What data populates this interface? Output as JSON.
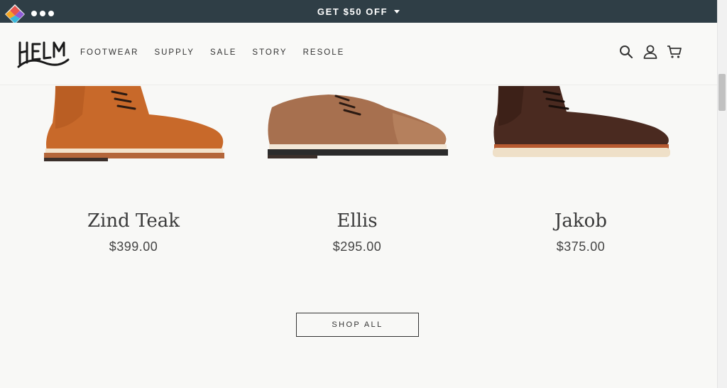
{
  "promo_bar": {
    "text": "GET $50 OFF",
    "caret_icon": "caret-down-icon",
    "background": "#2f3e46"
  },
  "extension": {
    "logo_icon": "extension-logo-icon",
    "menu_icon": "more-dots-icon"
  },
  "header": {
    "logo_text": "HELM",
    "nav": [
      {
        "label": "FOOTWEAR"
      },
      {
        "label": "SUPPLY"
      },
      {
        "label": "SALE"
      },
      {
        "label": "STORY"
      },
      {
        "label": "RESOLE"
      }
    ],
    "icons": [
      "search-icon",
      "account-icon",
      "cart-icon"
    ]
  },
  "products": [
    {
      "name": "Zind Teak",
      "price": "$399.00",
      "color": "#c8692a"
    },
    {
      "name": "Ellis",
      "price": "$295.00",
      "color": "#a7704f"
    },
    {
      "name": "Jakob",
      "price": "$375.00",
      "color": "#4a2a20"
    }
  ],
  "cta": {
    "shop_all_label": "SHOP ALL"
  }
}
